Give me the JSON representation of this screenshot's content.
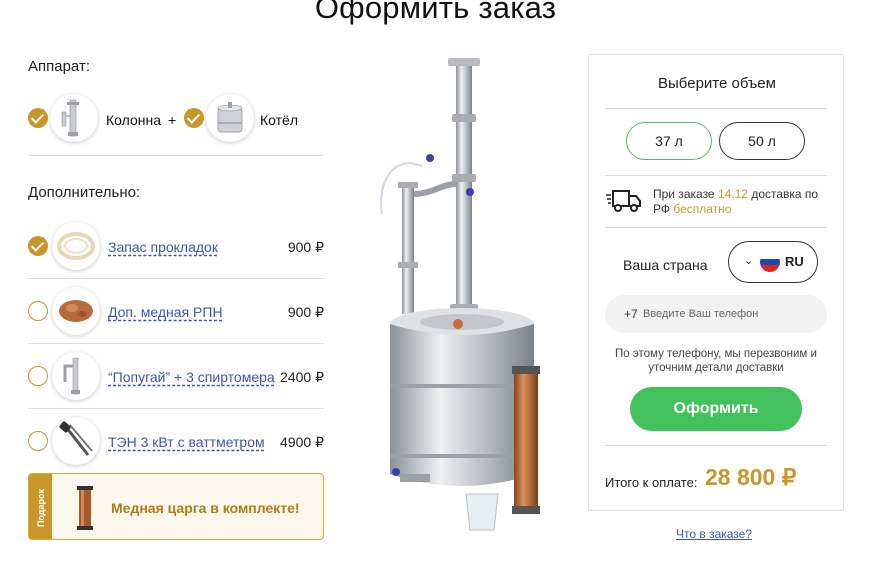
{
  "page": {
    "title": "Оформить заказ"
  },
  "apparatus": {
    "label": "Аппарат:",
    "items": [
      {
        "name": "Колонна",
        "checked": true,
        "icon": "column-icon"
      },
      {
        "name": "Котёл",
        "checked": true,
        "icon": "boiler-icon"
      }
    ],
    "plus": "+"
  },
  "extras": {
    "label": "Дополнительно:",
    "items": [
      {
        "name": "Запас прокладок",
        "price": "900 ₽",
        "checked": true,
        "icon": "gasket-icon"
      },
      {
        "name": "Доп. медная РПН",
        "price": "900 ₽",
        "checked": false,
        "icon": "copper-mesh-icon"
      },
      {
        "name": "“Попугай” + 3 спиртомера",
        "price": "2400 ₽",
        "checked": false,
        "icon": "parrot-icon"
      },
      {
        "name": "ТЭН 3 кВт с ваттметром",
        "price": "4900 ₽",
        "checked": false,
        "icon": "heater-icon"
      }
    ]
  },
  "promo": {
    "tag": "Подарок",
    "text": "Медная царга в комплекте!"
  },
  "order": {
    "title": "Выберите объем",
    "volumes": [
      {
        "label": "37 л",
        "active": true
      },
      {
        "label": "50 л",
        "active": false
      }
    ],
    "delivery_pre": "При заказе ",
    "delivery_date": "14.12",
    "delivery_mid": " доставка по РФ ",
    "delivery_free": "бесплатно",
    "country_label": "Ваша страна",
    "country_code": "RU",
    "phone_prefix": "+7",
    "phone_placeholder": "Введите Ваш телефон",
    "hint": "По этому телефону, мы перезвоним и уточним детали доставки",
    "submit_label": "Оформить",
    "total_label": "Итого к оплате:",
    "total_value": "28 800 ₽"
  },
  "links": {
    "whats_in_order": "Что в заказе?"
  },
  "colors": {
    "accent": "#c9962a",
    "link": "#3d56b2",
    "submit": "#43c15c",
    "active_border": "#57b874"
  }
}
